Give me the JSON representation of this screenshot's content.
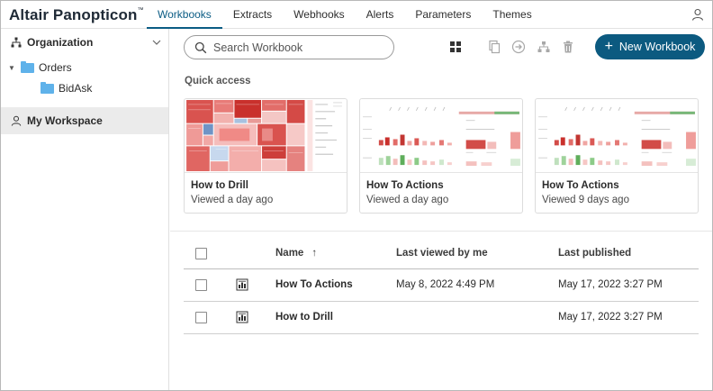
{
  "app": {
    "logo": "Altair Panopticon",
    "tm": "™"
  },
  "nav": {
    "tabs": [
      {
        "label": "Workbooks",
        "active": true
      },
      {
        "label": "Extracts"
      },
      {
        "label": "Webhooks"
      },
      {
        "label": "Alerts"
      },
      {
        "label": "Parameters"
      },
      {
        "label": "Themes"
      }
    ]
  },
  "sidebar": {
    "organization": "Organization",
    "folders": [
      {
        "label": "Orders"
      },
      {
        "label": "BidAsk"
      }
    ],
    "my_workspace": "My Workspace"
  },
  "toolbar": {
    "search_placeholder": "Search Workbook",
    "new_workbook": "New Workbook",
    "icons": [
      "grid-view-icon",
      "copy-icon",
      "move-icon",
      "hierarchy-icon",
      "delete-icon"
    ]
  },
  "quick_access": {
    "title": "Quick access",
    "cards": [
      {
        "title": "How to Drill",
        "sub": "Viewed a day ago"
      },
      {
        "title": "How To Actions",
        "sub": "Viewed a day ago"
      },
      {
        "title": "How To Actions",
        "sub": "Viewed 9 days ago"
      }
    ]
  },
  "table": {
    "columns": {
      "name": "Name",
      "sort": "↑",
      "last_viewed": "Last viewed by me",
      "last_published": "Last published"
    },
    "rows": [
      {
        "name": "How To Actions",
        "last_viewed": "May 8, 2022 4:49 PM",
        "last_published": "May 17, 2022 3:27 PM"
      },
      {
        "name": "How to Drill",
        "last_viewed": "",
        "last_published": "May 17, 2022 3:27 PM"
      }
    ]
  },
  "colors": {
    "accent": "#0c5a80",
    "folder": "#5fb2ea",
    "selected_bg": "#ebebeb"
  }
}
